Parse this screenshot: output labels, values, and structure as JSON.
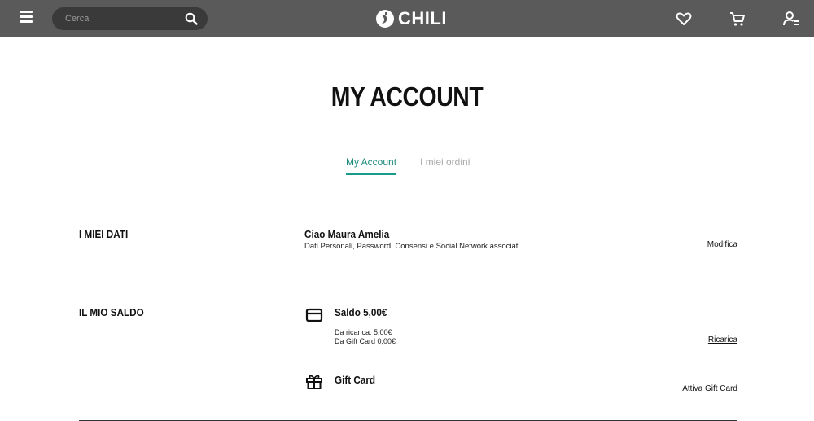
{
  "header": {
    "search_placeholder": "Cerca",
    "logo_text": "CHILI",
    "icons": [
      "menu-icon",
      "search-icon",
      "heart-icon",
      "cart-icon",
      "user-icon"
    ],
    "colors": {
      "bar": "#5a5a5a",
      "search_bg": "#3a3a3a",
      "accent": "#1a9a88"
    }
  },
  "page": {
    "title": "MY ACCOUNT"
  },
  "tabs": [
    {
      "label": "My Account",
      "active": true
    },
    {
      "label": "I miei ordini",
      "active": false
    }
  ],
  "sections": {
    "dati": {
      "label": "I MIEI DATI",
      "greeting": "Ciao Maura Amelia",
      "description": "Dati Personali, Password, Consensi e Social Network associati",
      "action": "Modifica"
    },
    "saldo": {
      "label": "IL MIO SALDO",
      "balance_title": "Saldo 5,00€",
      "detail_ricarica": "Da ricarica: 5,00€",
      "detail_giftcard": "Da Gift Card 0,00€",
      "balance_action": "Ricarica",
      "giftcard_title": "Gift Card",
      "giftcard_action": "Attiva Gift Card"
    }
  }
}
